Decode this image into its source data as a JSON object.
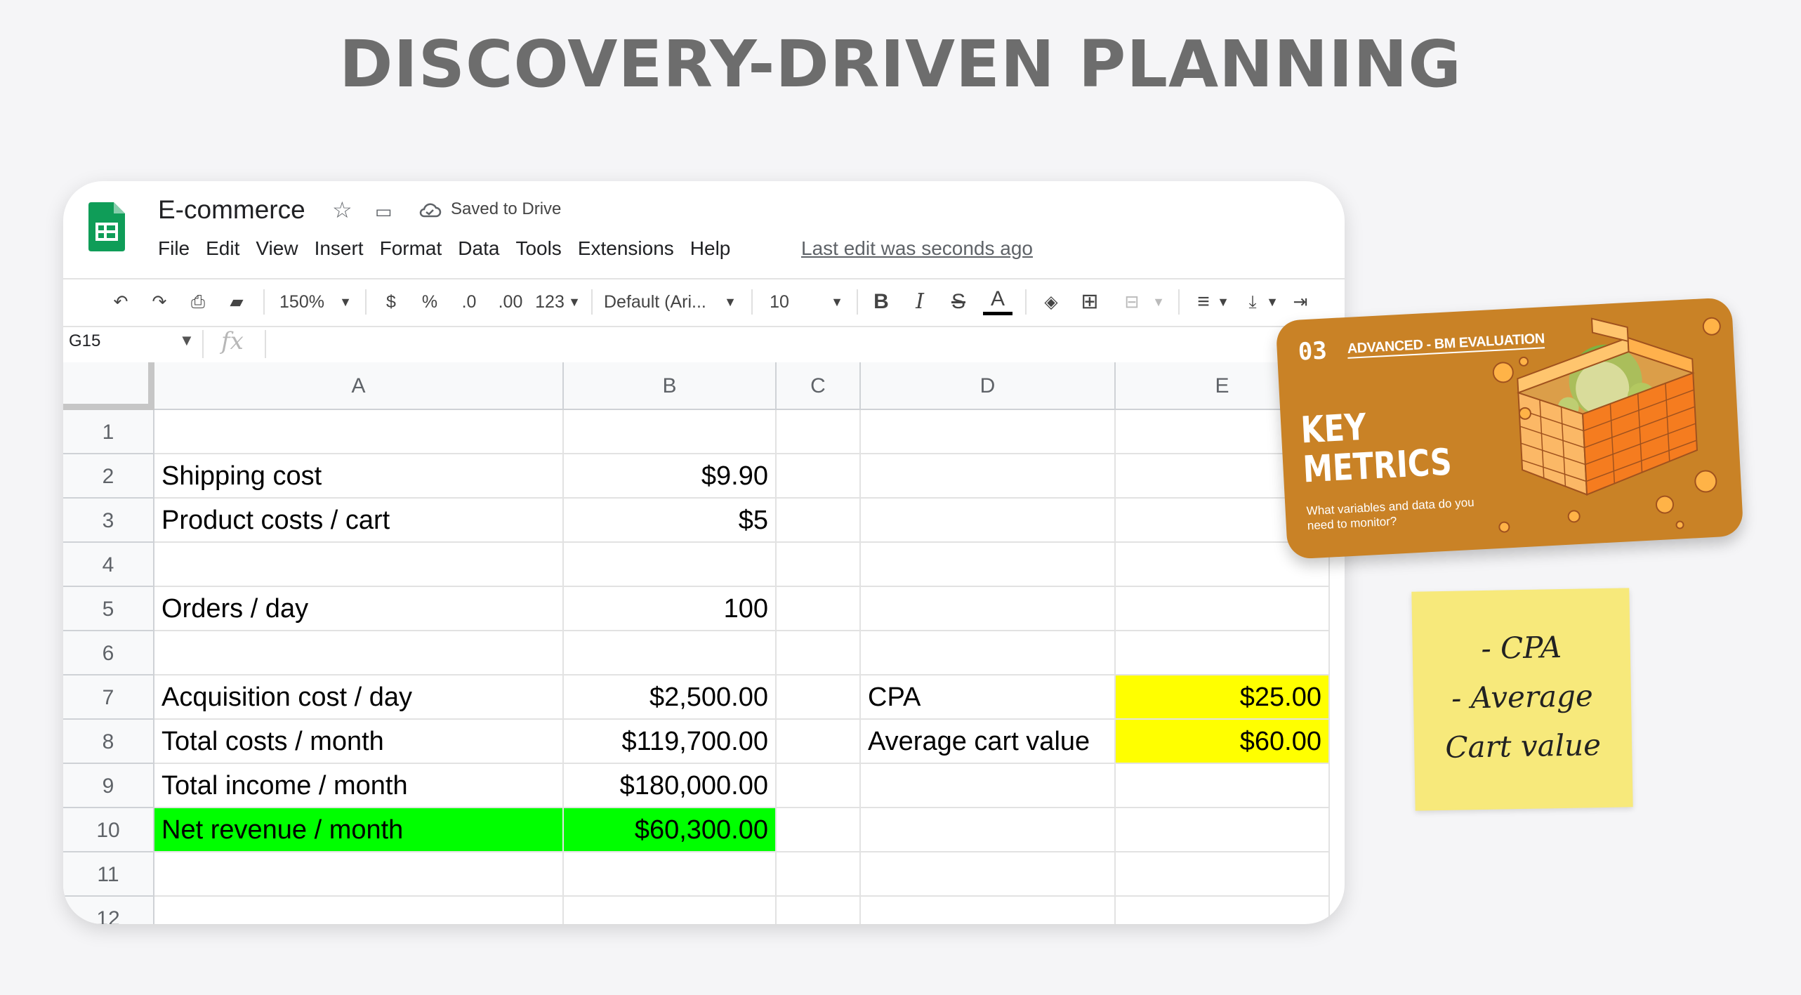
{
  "headline": "DISCOVERY-DRIVEN PLANNING",
  "app": {
    "doc_title": "E-commerce",
    "saved_status": "Saved to Drive",
    "menu": [
      "File",
      "Edit",
      "View",
      "Insert",
      "Format",
      "Data",
      "Tools",
      "Extensions",
      "Help"
    ],
    "last_edit": "Last edit was seconds ago",
    "brand_color": "#0f9d58"
  },
  "toolbar": {
    "zoom": "150%",
    "currency": "$",
    "percent": "%",
    "decrease_decimal": ".0",
    "increase_decimal": ".00",
    "more_formats": "123",
    "font": "Default (Ari...",
    "font_size": "10",
    "bold": "B",
    "italic": "I",
    "strikethrough": "S",
    "text_color": "A"
  },
  "formula_bar": {
    "cell_ref": "G15",
    "fx": "fx"
  },
  "sheet": {
    "columns": [
      "A",
      "B",
      "C",
      "D",
      "E"
    ],
    "rows": [
      "1",
      "2",
      "3",
      "4",
      "5",
      "6",
      "7",
      "8",
      "9",
      "10",
      "11",
      "12"
    ],
    "cells": {
      "A2": "Shipping cost",
      "B2": "$9.90",
      "A3": "Product costs / cart",
      "B3": "$5",
      "A5": "Orders / day",
      "B5": "100",
      "A7": "Acquisition cost / day",
      "B7": "$2,500.00",
      "D7": "CPA",
      "E7": "$25.00",
      "A8": "Total costs / month",
      "B8": "$119,700.00",
      "D8": "Average cart value",
      "E8": "$60.00",
      "A9": "Total income / month",
      "B9": "$180,000.00",
      "A10": "Net revenue / month",
      "B10": "$60,300.00"
    },
    "highlight_green": "#00ff00",
    "highlight_yellow": "#ffff00"
  },
  "card": {
    "number": "03",
    "subtitle": "ADVANCED - BM EVALUATION",
    "title_line1": "KEY",
    "title_line2": "METRICS",
    "question": "What variables and data do you need to monitor?",
    "color": "#c98226"
  },
  "note": {
    "line1": "- CPA",
    "line2": "- Average",
    "line3": "Cart value"
  }
}
